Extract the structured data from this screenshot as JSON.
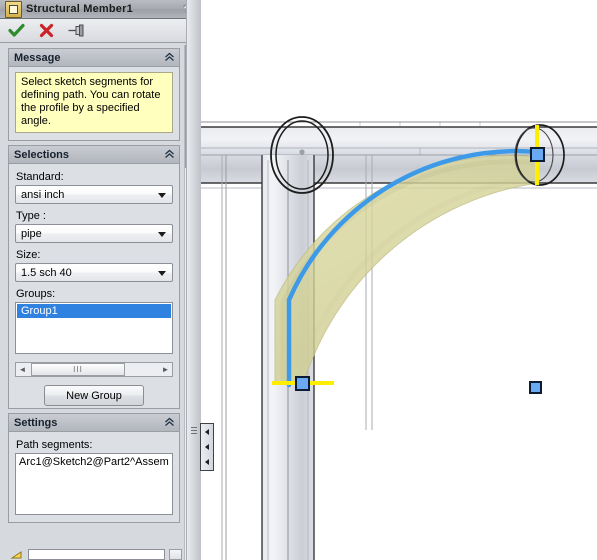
{
  "window": {
    "title": "Structural Member1",
    "icon": "structural-member-icon",
    "help_label": "?"
  },
  "toolbar": {
    "ok_label": "✔",
    "cancel_label": "✘",
    "pin_label": "pin",
    "ok_name": "accept-ok-icon",
    "cancel_name": "cancel-icon",
    "pin_name": "pushpin-icon"
  },
  "message_panel": {
    "title": "Message",
    "collapse_glyph": "«",
    "text": "Select sketch segments for defining path. You can rotate the profile by a specified angle."
  },
  "selections_panel": {
    "title": "Selections",
    "collapse_glyph": "«",
    "standard_label": "Standard:",
    "standard_value": "ansi inch",
    "type_label": "Type :",
    "type_value": "pipe",
    "size_label": "Size:",
    "size_value": "1.5 sch 40",
    "groups_label": "Groups:",
    "groups_items": [
      "Group1"
    ],
    "scroll_left_glyph": "◄",
    "scroll_right_glyph": "►",
    "scroll_thumb_glyph": "III",
    "new_group_label": "New Group"
  },
  "settings_panel": {
    "title": "Settings",
    "collapse_glyph": "«",
    "path_segments_label": "Path segments:",
    "path_segments_items": [
      "Arc1@Sketch2@Part2^Assem"
    ]
  },
  "panel_scrollbar": {
    "up_glyph": "▲"
  },
  "splitter": {
    "collapse_glyph": "◄"
  },
  "graphics": {
    "colors": {
      "preview_fill": "#d8d7a0",
      "preview_edge": "#c9c88d",
      "path_curve": "#3d9ae8",
      "selected_point": "#6aa9f4",
      "endpoint_line": "#ffee00",
      "member_light": "#e2e4ea",
      "member_mid": "#c9ccd4",
      "outline": "#3a3a3a",
      "sketch_line": "#9a9a9a"
    },
    "items": [
      {
        "name": "horizontal-structural-member",
        "type": "pipe-member"
      },
      {
        "name": "vertical-structural-member",
        "type": "pipe-member"
      },
      {
        "name": "profile-ellipse",
        "type": "sketch-profile"
      },
      {
        "name": "arc-preview-body",
        "type": "preview-solid"
      },
      {
        "name": "path-arc-curve",
        "type": "selected-sketch-arc"
      },
      {
        "name": "endpoint-marker-top",
        "type": "endpoint"
      },
      {
        "name": "endpoint-marker-bottom",
        "type": "endpoint"
      },
      {
        "name": "origin-point-marker",
        "type": "point"
      }
    ]
  }
}
